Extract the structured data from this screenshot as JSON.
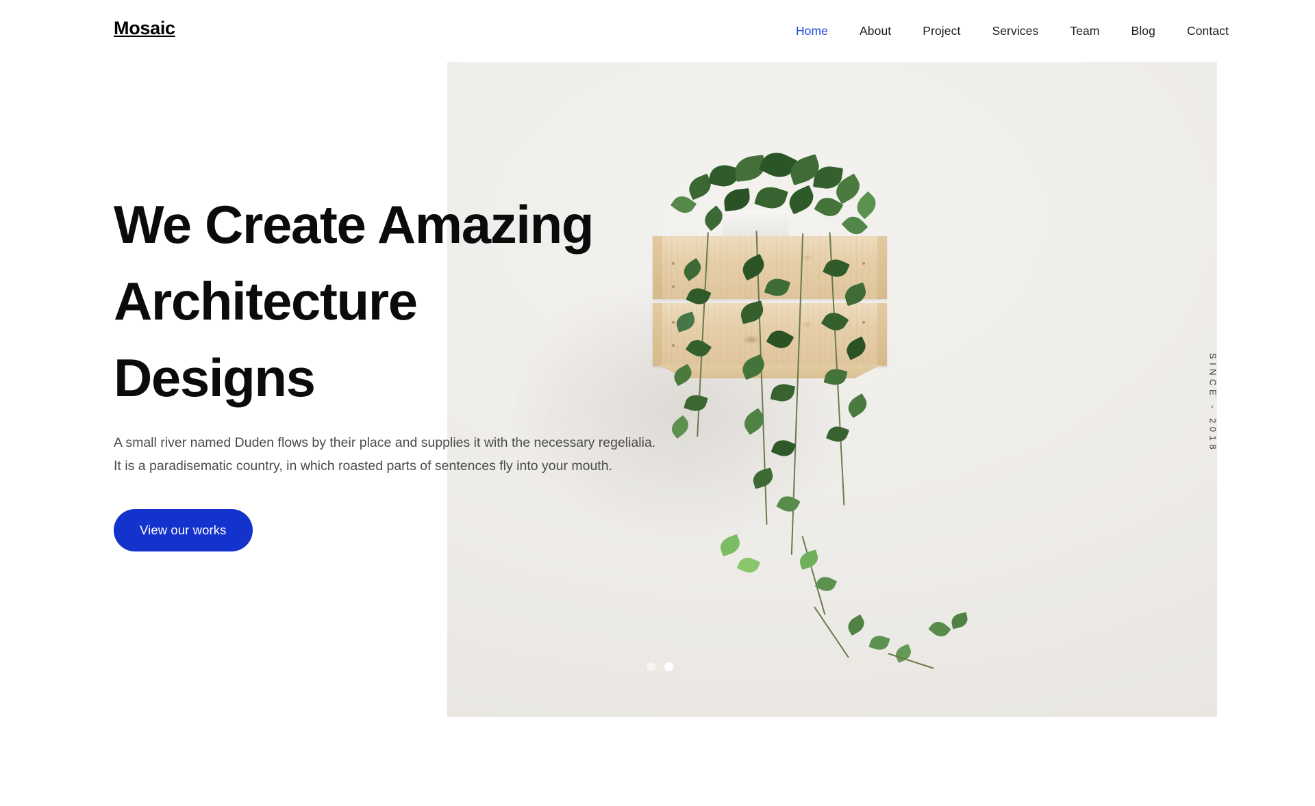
{
  "brand": {
    "name": "Mosaic"
  },
  "nav": {
    "items": [
      {
        "label": "Home",
        "active": true
      },
      {
        "label": "About",
        "active": false
      },
      {
        "label": "Project",
        "active": false
      },
      {
        "label": "Services",
        "active": false
      },
      {
        "label": "Team",
        "active": false
      },
      {
        "label": "Blog",
        "active": false
      },
      {
        "label": "Contact",
        "active": false
      }
    ]
  },
  "hero": {
    "title_lines": [
      "We Create Amazing",
      "Architecture",
      "Designs"
    ],
    "paragraph": "A small river named Duden flows by their place and supplies it with the necessary regelialia. It is a paradisematic country, in which roasted parts of sentences fly into your mouth.",
    "cta_label": "View our works",
    "since_label": "SINCE - 2018",
    "image_alt": "wall-mounted wooden planter with trailing ivy plant",
    "slides": [
      {
        "active": false
      },
      {
        "active": true
      }
    ]
  },
  "colors": {
    "accent_blue": "#1333CC",
    "nav_active_blue": "#1B47DF",
    "heading_black": "#0B0B0B",
    "body_gray": "#4A4A4A",
    "photo_background": "#EFEDEA",
    "page_background": "#FFFFFF",
    "wood_light": "#EEDCBE",
    "leaf_green": "#3F6B36"
  }
}
